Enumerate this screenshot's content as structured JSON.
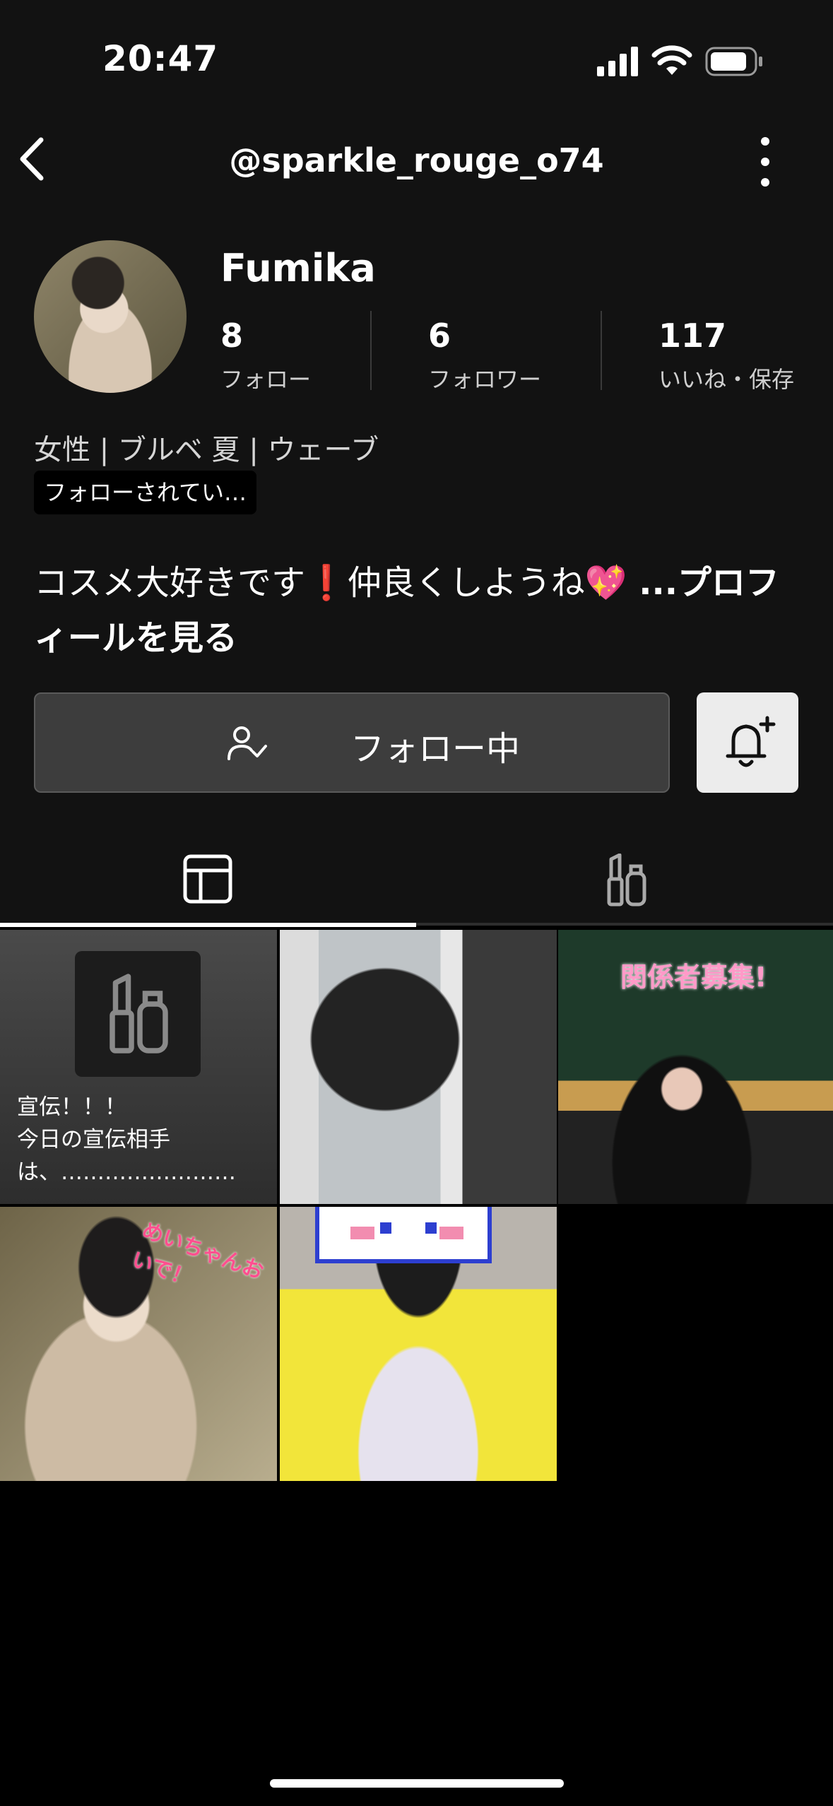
{
  "status_bar": {
    "time": "20:47"
  },
  "nav": {
    "handle": "@sparkle_rouge_o74"
  },
  "profile": {
    "name": "Fumika",
    "stats": [
      {
        "value": "8",
        "label": "フォロー"
      },
      {
        "value": "6",
        "label": "フォロワー"
      },
      {
        "value": "117",
        "label": "いいね・保存"
      }
    ],
    "meta": "女性 | ブルベ 夏 | ウェーブ",
    "follows_you_badge": "フォローされてい…",
    "bio": "コスメ大好きです❗️仲良くしようね💖",
    "bio_more": " ...プロフィールを見る"
  },
  "actions": {
    "follow_label": "フォロー中"
  },
  "tabs": [
    {
      "icon": "grid-icon",
      "active": true
    },
    {
      "icon": "cosmetics-icon",
      "active": false
    }
  ],
  "grid": {
    "post1_text_line1": "宣伝！！！",
    "post1_text_line2": "今日の宣伝相手",
    "post1_text_line3": "は、……………………",
    "post3_overlay": "関係者募集!",
    "post4_overlay": "めいちゃんおいで！"
  },
  "colors": {
    "background": "#121212",
    "accent": "#ffffff",
    "button": "#3d3d3d"
  }
}
